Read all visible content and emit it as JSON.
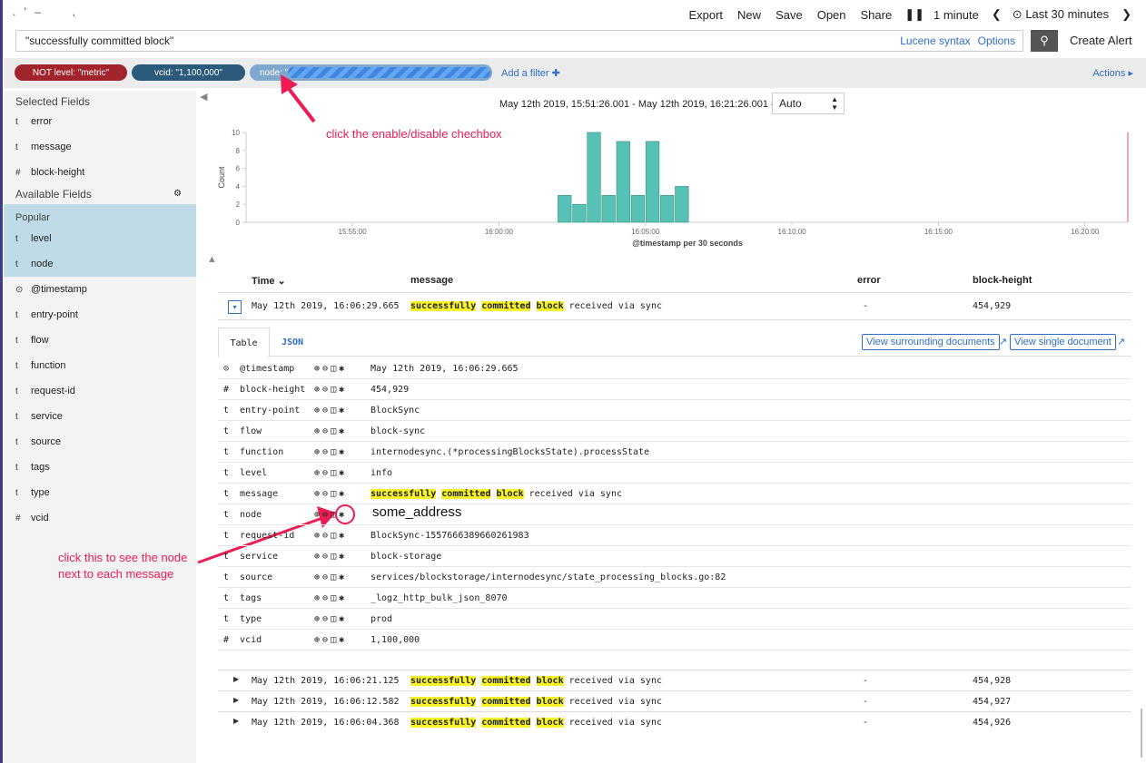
{
  "topnav": {
    "export": "Export",
    "new": "New",
    "save": "Save",
    "open": "Open",
    "share": "Share",
    "pause": "❚❚",
    "interval": "1 minute",
    "prev": "❮",
    "time_range": "Last 30 minutes",
    "next": "❯"
  },
  "search": {
    "query": "\"successfully committed block\"",
    "lucene": "Lucene syntax",
    "options": "Options",
    "create_alert": "Create Alert"
  },
  "filters": {
    "not_level": "NOT level: \"metric\"",
    "vcid": "vcid: \"1,100,000\"",
    "node": "node: \"",
    "add_filter": "Add a filter ✚",
    "actions": "Actions ▸"
  },
  "sidebar": {
    "selected_header": "Selected Fields",
    "selected": [
      {
        "type": "t",
        "name": "error"
      },
      {
        "type": "t",
        "name": "message"
      },
      {
        "type": "#",
        "name": "block-height"
      }
    ],
    "available_header": "Available Fields",
    "popular_label": "Popular",
    "popular": [
      {
        "type": "t",
        "name": "level"
      },
      {
        "type": "t",
        "name": "node"
      }
    ],
    "others": [
      {
        "type": "⊙",
        "name": "@timestamp"
      },
      {
        "type": "t",
        "name": "entry-point"
      },
      {
        "type": "t",
        "name": "flow"
      },
      {
        "type": "t",
        "name": "function"
      },
      {
        "type": "t",
        "name": "request-id"
      },
      {
        "type": "t",
        "name": "service"
      },
      {
        "type": "t",
        "name": "source"
      },
      {
        "type": "t",
        "name": "tags"
      },
      {
        "type": "t",
        "name": "type"
      },
      {
        "type": "#",
        "name": "vcid"
      }
    ]
  },
  "histogram": {
    "date_range": "May 12th 2019, 15:51:26.001 - May 12th 2019, 16:21:26.001 —",
    "interval": "Auto"
  },
  "chart_data": {
    "type": "bar",
    "ylabel": "Count",
    "xlabel": "@timestamp per 30 seconds",
    "ylim": [
      0,
      10
    ],
    "y_ticks": [
      "0",
      "2",
      "4",
      "6",
      "8",
      "10"
    ],
    "x_ticks": [
      "15:55:00",
      "16:00:00",
      "16:05:00",
      "16:10:00",
      "16:15:00",
      "16:20:00"
    ],
    "categories": [
      "16:02:00",
      "16:02:30",
      "16:03:00",
      "16:03:30",
      "16:04:00",
      "16:04:30",
      "16:05:00",
      "16:05:30",
      "16:06:00"
    ],
    "values": [
      3,
      2,
      10,
      3,
      9,
      3,
      9,
      3,
      4
    ],
    "bar_color": "#57c1b5"
  },
  "annotations": {
    "filter_hint": "click the enable/disable chechbox",
    "node_hint_1": "click this to see the node",
    "node_hint_2": "next to each message",
    "some_address": "some_address"
  },
  "table": {
    "headers": {
      "time": "Time ⌄",
      "message": "message",
      "error": "error",
      "block_height": "block-height"
    },
    "expanded": {
      "time": "May 12th 2019, 16:06:29.665",
      "msg_pre": "",
      "hl1": "successfully",
      "hl2": "committed",
      "hl3": "block",
      "msg_post": "received via sync",
      "error": "-",
      "block_height": "454,929"
    },
    "rows": [
      {
        "time": "May 12th 2019, 16:06:21.125",
        "error": "-",
        "block_height": "454,928"
      },
      {
        "time": "May 12th 2019, 16:06:12.582",
        "error": "-",
        "block_height": "454,927"
      },
      {
        "time": "May 12th 2019, 16:06:04.368",
        "error": "-",
        "block_height": "454,926"
      }
    ]
  },
  "detail": {
    "tab_table": "Table",
    "tab_json": "JSON",
    "view_surrounding": "View surrounding documents",
    "view_single": "View single document",
    "tools": "🔍︎ 🔍︎ ◫ ✱",
    "fields": [
      {
        "type": "⊙",
        "key": "@timestamp",
        "value": "May 12th 2019, 16:06:29.665"
      },
      {
        "type": "#",
        "key": "block-height",
        "value": "454,929"
      },
      {
        "type": "t",
        "key": "entry-point",
        "value": "BlockSync"
      },
      {
        "type": "t",
        "key": "flow",
        "value": "block-sync"
      },
      {
        "type": "t",
        "key": "function",
        "value": "internodesync.(*processingBlocksState).processState"
      },
      {
        "type": "t",
        "key": "level",
        "value": "info"
      },
      {
        "type": "t",
        "key": "message",
        "value": ""
      },
      {
        "type": "t",
        "key": "node",
        "value": ""
      },
      {
        "type": "t",
        "key": "request-id",
        "value": "BlockSync-1557666389660261983"
      },
      {
        "type": "t",
        "key": "service",
        "value": "block-storage"
      },
      {
        "type": "t",
        "key": "source",
        "value": "services/blockstorage/internodesync/state_processing_blocks.go:82"
      },
      {
        "type": "t",
        "key": "tags",
        "value": "_logz_http_bulk_json_8070"
      },
      {
        "type": "t",
        "key": "type",
        "value": "prod"
      },
      {
        "type": "#",
        "key": "vcid",
        "value": "1,100,000"
      }
    ]
  }
}
